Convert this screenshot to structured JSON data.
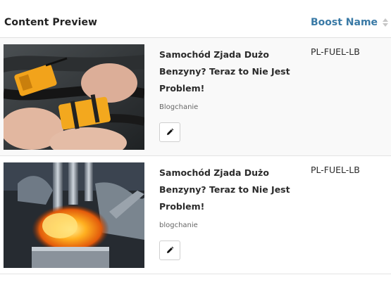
{
  "table": {
    "columns": {
      "content_preview": "Content Preview",
      "boost_name": "Boost Name"
    },
    "rows": [
      {
        "headline": "Samochód Zjada Dużo Benzyny? Teraz to Nie Jest Problem!",
        "source": "Blogchanie",
        "boost": "PL-FUEL-LB",
        "thumbnail_icon": "fuel-saver-magnets-image"
      },
      {
        "headline": "Samochód Zjada Dużo Benzyny? Teraz to Nie Jest Problem!",
        "source": "blogchanie",
        "boost": "PL-FUEL-LB",
        "thumbnail_icon": "engine-combustion-image"
      }
    ]
  },
  "colors": {
    "header_link": "#3a7aa6",
    "row_odd": "#f9f9f9",
    "border": "#e3e3e3"
  },
  "icons": {
    "edit": "pencil-icon",
    "sort": "sort-arrows-icon"
  }
}
